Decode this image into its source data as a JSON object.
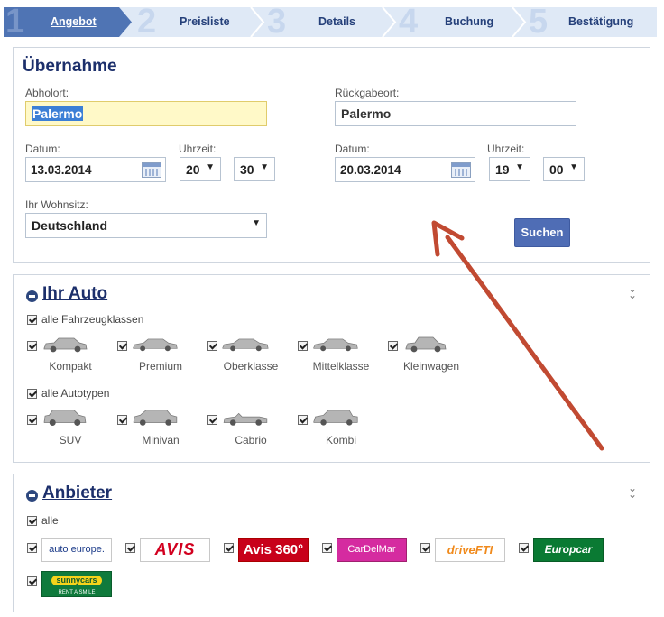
{
  "steps": [
    {
      "num": "1",
      "label": "Angebot"
    },
    {
      "num": "2",
      "label": "Preisliste"
    },
    {
      "num": "3",
      "label": "Details"
    },
    {
      "num": "4",
      "label": "Buchung"
    },
    {
      "num": "5",
      "label": "Bestätigung"
    }
  ],
  "pickup": {
    "title": "Übernahme",
    "pickup_label": "Abholort:",
    "pickup_value": "Palermo",
    "return_label": "Rückgabeort:",
    "return_value": "Palermo",
    "date_label": "Datum:",
    "time_label": "Uhrzeit:",
    "pickup_date": "13.03.2014",
    "pickup_hour": "20",
    "pickup_min": "30",
    "return_date": "20.03.2014",
    "return_hour": "19",
    "return_min": "00",
    "residence_label": "Ihr Wohnsitz:",
    "residence_value": "Deutschland",
    "search_button": "Suchen"
  },
  "auto": {
    "title": "Ihr Auto",
    "all_classes": "alle Fahrzeugklassen",
    "classes": [
      "Kompakt",
      "Premium",
      "Oberklasse",
      "Mittelklasse",
      "Kleinwagen"
    ],
    "all_types": "alle Autotypen",
    "types": [
      "SUV",
      "Minivan",
      "Cabrio",
      "Kombi"
    ]
  },
  "vendors": {
    "title": "Anbieter",
    "all": "alle",
    "logos": [
      "auto europe.",
      "AVIS",
      "Avis 360°",
      "CarDelMar",
      "driveFTI",
      "Europcar",
      "sunnycars"
    ],
    "sunny_sub": "RENT A SMILE"
  },
  "colors": {
    "accent": "#4f74b4",
    "title": "#1c2f6b",
    "arrow": "#c0392b"
  }
}
